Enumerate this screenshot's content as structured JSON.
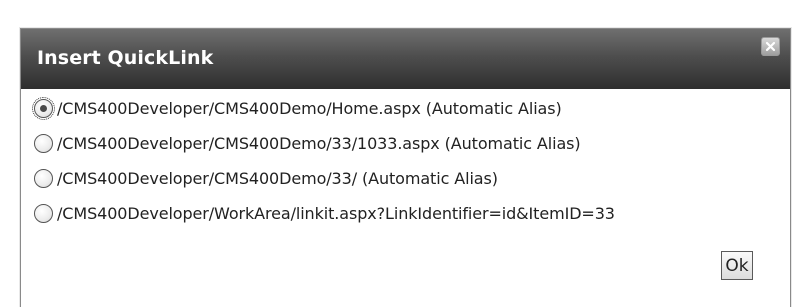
{
  "dialog": {
    "title": "Insert QuickLink",
    "close_icon": "close-icon",
    "options": [
      {
        "label": "/CMS400Developer/CMS400Demo/Home.aspx (Automatic Alias)",
        "selected": true
      },
      {
        "label": "/CMS400Developer/CMS400Demo/33/1033.aspx (Automatic Alias)",
        "selected": false
      },
      {
        "label": "/CMS400Developer/CMS400Demo/33/ (Automatic Alias)",
        "selected": false
      },
      {
        "label": "/CMS400Developer/WorkArea/linkit.aspx?LinkIdentifier=id&ItemID=33",
        "selected": false
      }
    ],
    "ok_label": "Ok"
  }
}
